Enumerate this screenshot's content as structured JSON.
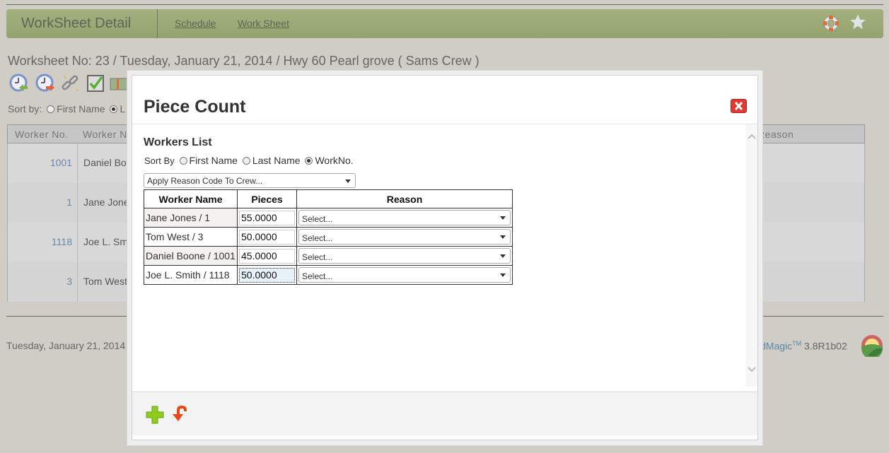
{
  "header": {
    "title": "WorkSheet Detail",
    "links": [
      "Schedule",
      "Work Sheet"
    ],
    "icons": [
      "help-lifebuoy-icon",
      "favorite-star-icon"
    ]
  },
  "worksheet": {
    "title": "Worksheet No: 23 / Tuesday, January 21, 2014 / Hwy 60 Pearl grove ( Sams Crew )",
    "toolbar_icons": [
      "clock-in-icon",
      "clock-out-icon",
      "unlink-icon",
      "checkbox-icon",
      "money-icon"
    ],
    "sort_label": "Sort by:",
    "sort_options": [
      "First Name",
      "L"
    ],
    "table": {
      "headers": [
        "Worker No.",
        "Worker N",
        "Reason"
      ],
      "rows": [
        {
          "number": "1001",
          "name": "Daniel Boo"
        },
        {
          "number": "1",
          "name": "Jane Jone"
        },
        {
          "number": "1118",
          "name": "Joe L. Sm"
        },
        {
          "number": "3",
          "name": "Tom West"
        }
      ]
    }
  },
  "footer": {
    "date": "Tuesday, January 21, 2014",
    "brand": "dMagic",
    "tm": "TM",
    "version": "3.8R1b02"
  },
  "modal": {
    "title": "Piece Count",
    "close_icon": "close-icon",
    "workers_list_title": "Workers List",
    "sort_by_label": "Sort By",
    "sort_options": [
      {
        "label": "First Name",
        "checked": false
      },
      {
        "label": "Last Name",
        "checked": false
      },
      {
        "label": "WorkNo.",
        "checked": true
      }
    ],
    "crew_select": "Apply Reason Code To Crew...",
    "table": {
      "headers": [
        "Worker Name",
        "Pieces",
        "Reason"
      ],
      "rows": [
        {
          "name": "Jane Jones / 1",
          "pieces": "55.0000",
          "reason": "Select..."
        },
        {
          "name": "Tom West / 3",
          "pieces": "50.0000",
          "reason": "Select..."
        },
        {
          "name": "Daniel Boone / 1001",
          "pieces": "45.0000",
          "reason": "Select..."
        },
        {
          "name": "Joe L. Smith / 1118",
          "pieces": "50.0000",
          "reason": "Select..."
        }
      ]
    },
    "footer_icons": [
      "add-icon",
      "undo-icon"
    ]
  }
}
